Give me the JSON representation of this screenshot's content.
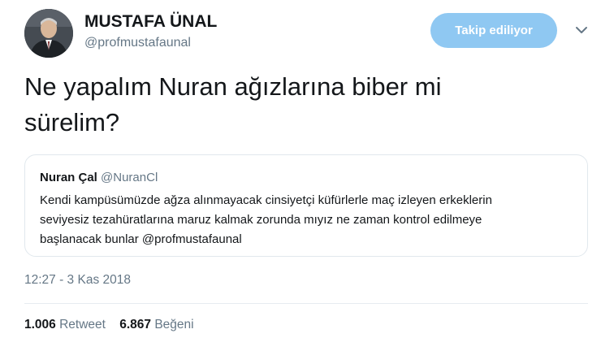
{
  "author": {
    "name": "MUSTAFA ÜNAL",
    "handle": "@profmustafaunal"
  },
  "follow_button": {
    "label": "Takip ediliyor",
    "color": "#8fc8f2"
  },
  "tweet": {
    "text_line1": "Ne yapalım Nuran ağızlarına biber mi",
    "text_line2": "sürelim?"
  },
  "quoted_tweet": {
    "name": "Nuran Çal",
    "handle": "@NuranCl",
    "text_line1": "Kendi kampüsümüzde ağza alınmayacak cinsiyetçi küfürlerle maç izleyen erkeklerin",
    "text_line2": "seviyesiz tezahüratlarına maruz kalmak zorunda mıyız ne zaman kontrol edilmeye",
    "text_line3": "başlanacak bunlar  @profmustafaunal"
  },
  "timestamp": "12:27 - 3 Kas 2018",
  "stats": {
    "retweet_count": "1.006",
    "retweet_label": "Retweet",
    "like_count": "6.867",
    "like_label": "Beğeni"
  },
  "icons": {
    "more": "chevron-down-icon"
  }
}
